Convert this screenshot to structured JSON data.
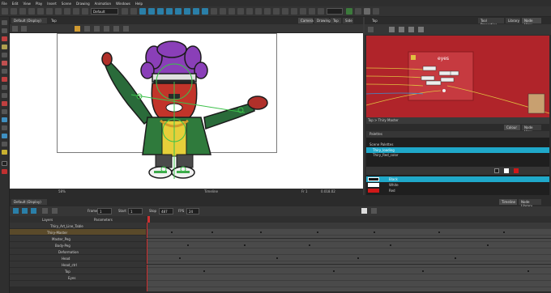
{
  "menu": [
    "File",
    "Edit",
    "View",
    "Play",
    "Insert",
    "Scene",
    "Drawing",
    "Animation",
    "Windows",
    "Help"
  ],
  "toolbar": {
    "workspace": "Default"
  },
  "viewer": {
    "tab_label": "Default (Display)",
    "title": "Top",
    "view_tabs": [
      "Camera",
      "Drawing",
      "Top",
      "Side"
    ],
    "zoom": "58%",
    "status_frame": "Fr 1",
    "status_coords": "0.018.02",
    "status_center": "Timeline"
  },
  "right_panel": {
    "tabs": [
      "Tool Properties",
      "Library",
      "Node View"
    ],
    "node_tab": "Top",
    "node_label": "eyes",
    "breadcrumb": "Top > Thiry Master",
    "color_tabs": [
      "Colour",
      "Node View"
    ],
    "palettes_header": "Palettes",
    "palette_items": [
      "Scene Palettes",
      "Thiry_loading",
      "Thiry_Red_color"
    ],
    "swatches": [
      {
        "name": "Black",
        "color": "#111111"
      },
      {
        "name": "White",
        "color": "#ffffff"
      },
      {
        "name": "Red",
        "color": "#d01818"
      }
    ]
  },
  "timeline": {
    "tab_label": "Default (Display)",
    "tabs": [
      "Timeline",
      "Node Library"
    ],
    "frame_label": "Frame",
    "frame_value": "1",
    "start_label": "Start",
    "start_value": "1",
    "stop_label": "Stop",
    "stop_value": "487",
    "fps_label": "FPS",
    "fps_value": "24",
    "layers_header": "Layers",
    "params_header": "Parameters",
    "layers": [
      "Thiry_Art_Line_Table",
      "Thiry-Master",
      "Master_Peg",
      "Body-Peg",
      "Deformation",
      "Head",
      "Head_ctrl",
      "Top",
      "Eyes"
    ]
  },
  "accent_colors": {
    "node_bg": "#b0242a",
    "selection": "#1fa8c9",
    "character_purple": "#8a3fb8"
  }
}
